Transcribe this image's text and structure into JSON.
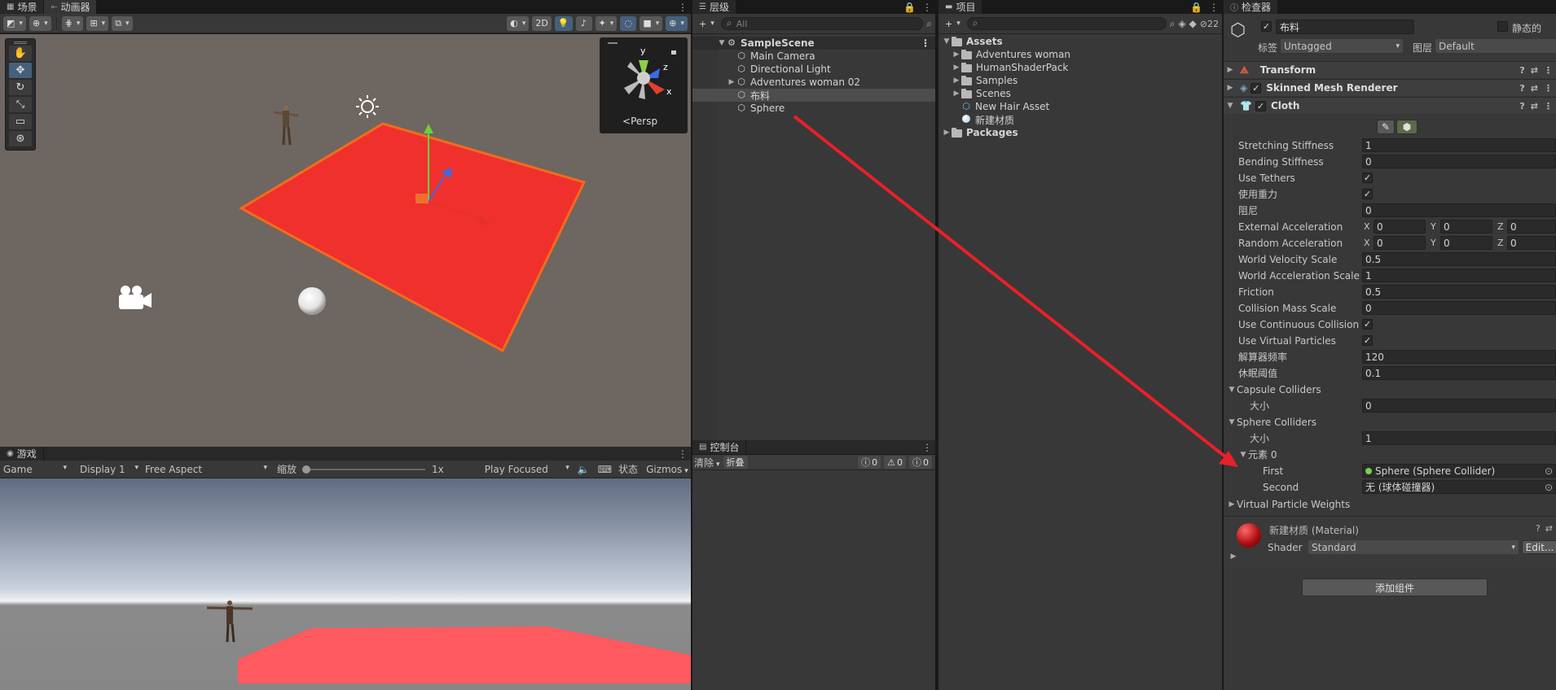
{
  "scene_tabs": {
    "scene": "场景",
    "animator": "动画器"
  },
  "scene_toolbar": {
    "btn_2d": "2D"
  },
  "scene_gizmo": {
    "persp": "Persp",
    "y": "y",
    "z": "z",
    "x": "x"
  },
  "game_tab": "游戏",
  "game_toolbar": {
    "display_mode": "Game",
    "display": "Display 1",
    "aspect": "Free Aspect",
    "scale_label": "缩放",
    "scale_value": "1x",
    "play_mode": "Play Focused",
    "stats": "状态",
    "gizmos": "Gizmos"
  },
  "hierarchy": {
    "tab": "层级",
    "search_placeholder": "All",
    "scene_name": "SampleScene",
    "items": [
      {
        "label": "Main Camera"
      },
      {
        "label": "Directional Light"
      },
      {
        "label": "Adventures woman 02"
      },
      {
        "label": "布料"
      },
      {
        "label": "Sphere"
      }
    ]
  },
  "console": {
    "tab": "控制台",
    "clear": "清除",
    "collapse": "折叠",
    "count_info": "0",
    "count_warn": "0",
    "count_error": "0"
  },
  "project": {
    "tab": "项目",
    "hidden_count": "22",
    "assets": "Assets",
    "items": [
      {
        "label": "Adventures woman"
      },
      {
        "label": "HumanShaderPack"
      },
      {
        "label": "Samples"
      },
      {
        "label": "Scenes"
      },
      {
        "label": "New Hair Asset"
      },
      {
        "label": "新建材质"
      }
    ],
    "packages": "Packages"
  },
  "inspector": {
    "tab": "检查器",
    "object_name": "布料",
    "static_label": "静态的",
    "tag_label": "标签",
    "tag_value": "Untagged",
    "layer_label": "图层",
    "layer_value": "Default",
    "components": {
      "transform": "Transform",
      "smr": "Skinned Mesh Renderer",
      "cloth": "Cloth"
    },
    "cloth": {
      "stretching": {
        "label": "Stretching Stiffness",
        "value": "1"
      },
      "bending": {
        "label": "Bending Stiffness",
        "value": "0"
      },
      "use_tethers": {
        "label": "Use Tethers",
        "value": "✓"
      },
      "use_gravity": {
        "label": "使用重力",
        "value": "✓"
      },
      "damping": {
        "label": "阻尼",
        "value": "0"
      },
      "ext_acc": {
        "label": "External Acceleration",
        "x": "0",
        "y": "0",
        "z": "0"
      },
      "rand_acc": {
        "label": "Random Acceleration",
        "x": "0",
        "y": "0",
        "z": "0"
      },
      "world_vel": {
        "label": "World Velocity Scale",
        "value": "0.5"
      },
      "world_acc": {
        "label": "World Acceleration Scale",
        "value": "1"
      },
      "friction": {
        "label": "Friction",
        "value": "0.5"
      },
      "coll_mass": {
        "label": "Collision Mass Scale",
        "value": "0"
      },
      "cont_coll": {
        "label": "Use Continuous Collision",
        "value": "✓"
      },
      "virt_part": {
        "label": "Use Virtual Particles",
        "value": "✓"
      },
      "solver_freq": {
        "label": "解算器频率",
        "value": "120"
      },
      "sleep": {
        "label": "休眠阈值",
        "value": "0.1"
      },
      "capsule": {
        "label": "Capsule Colliders",
        "size_label": "大小",
        "size": "0"
      },
      "sphere": {
        "label": "Sphere Colliders",
        "size_label": "大小",
        "size": "1",
        "element": "元素 0",
        "first_label": "First",
        "first_value": "Sphere (Sphere Collider)",
        "second_label": "Second",
        "second_value": "无 (球体碰撞器)"
      },
      "vpw": "Virtual Particle Weights"
    },
    "material": {
      "name": "新建材质 (Material)",
      "shader_label": "Shader",
      "shader_value": "Standard",
      "edit": "Edit..."
    },
    "add_component": "添加组件",
    "axis_x": "X",
    "axis_y": "Y",
    "axis_z": "Z"
  },
  "colors": {
    "cloth_plane": "#f0302c",
    "annotation_arrow": "#e8202a",
    "accent": "#46607c"
  }
}
